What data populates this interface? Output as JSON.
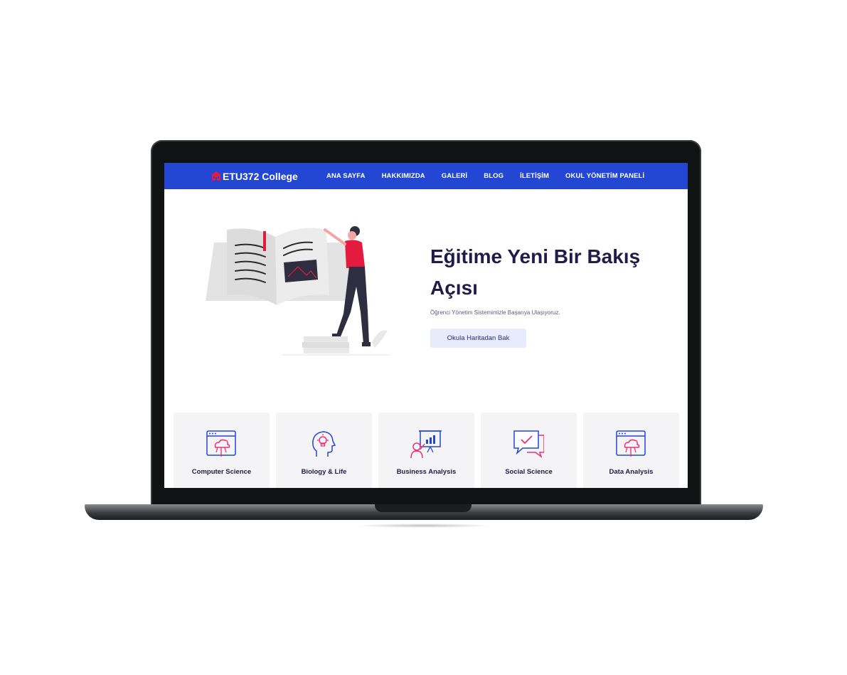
{
  "brand": {
    "name": "ETU372 College",
    "logo_icon": "school-building-icon",
    "accent": "#e31b3f"
  },
  "colors": {
    "nav": "#2346d3",
    "title": "#201c4a",
    "icon_blue": "#2346d3",
    "icon_pink": "#ec2f7a"
  },
  "nav": {
    "items": [
      "ANA SAYFA",
      "HAKKIMIZDA",
      "GALERİ",
      "BLOG",
      "İLETİŞİM",
      "OKUL YÖNETİM PANELİ"
    ]
  },
  "hero": {
    "title": "Eğitime Yeni Bir Bakış Açısı",
    "subtitle": "Öğrenci Yönetim Sistemimizle Başarıya Ulaşıyoruz.",
    "button": "Okula Haritadan Bak",
    "illustration": "woman-reading-giant-book-illustration"
  },
  "courses": [
    {
      "label": "Computer Science",
      "icon": "cloud-browser-icon"
    },
    {
      "label": "Biology & Life",
      "icon": "head-lightbulb-icon"
    },
    {
      "label": "Business Analysis",
      "icon": "presentation-chart-icon"
    },
    {
      "label": "Social Science",
      "icon": "chat-check-icon"
    },
    {
      "label": "Data Analysis",
      "icon": "cloud-browser-icon"
    }
  ]
}
